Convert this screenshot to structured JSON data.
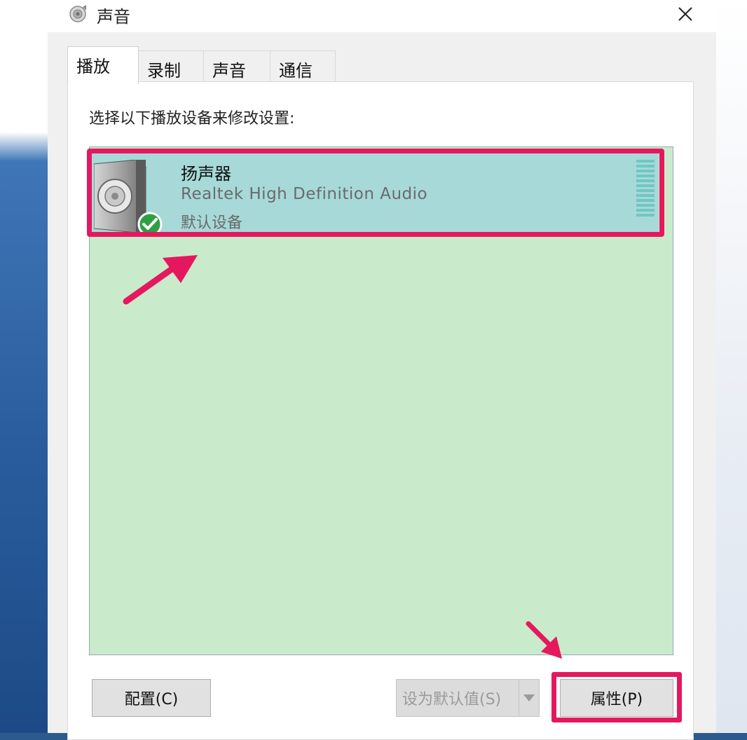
{
  "window": {
    "title": "声音"
  },
  "tabs": [
    {
      "label": "播放",
      "active": true
    },
    {
      "label": "录制",
      "active": false
    },
    {
      "label": "声音",
      "active": false
    },
    {
      "label": "通信",
      "active": false
    }
  ],
  "playback": {
    "instruction": "选择以下播放设备来修改设置:",
    "devices": [
      {
        "name": "扬声器",
        "driver": "Realtek High Definition Audio",
        "status": "默认设备",
        "selected": true,
        "is_default": true
      }
    ]
  },
  "buttons": {
    "configure": "配置(C)",
    "set_default": "设为默认值(S)",
    "properties": "属性(P)"
  },
  "colors": {
    "annotation": "#e5185f",
    "selected_row": "#a6d9d8",
    "list_background": "#c9ebcb"
  }
}
